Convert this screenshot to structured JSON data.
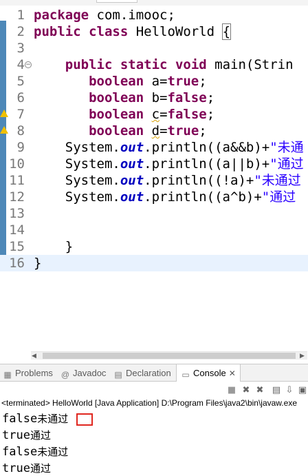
{
  "editor": {
    "lines": [
      {
        "num": "1",
        "tokens": [
          {
            "t": "package",
            "c": "kw"
          },
          {
            "t": " com.imooc;",
            "c": ""
          }
        ]
      },
      {
        "num": "2",
        "tokens": [
          {
            "t": "public",
            "c": "kw"
          },
          {
            "t": " ",
            "c": ""
          },
          {
            "t": "class",
            "c": "kw"
          },
          {
            "t": " HelloWorld ",
            "c": ""
          },
          {
            "t": "{",
            "c": "brace"
          }
        ]
      },
      {
        "num": "3",
        "tokens": []
      },
      {
        "num": "4",
        "tokens": [
          {
            "t": "    ",
            "c": ""
          },
          {
            "t": "public",
            "c": "kw"
          },
          {
            "t": " ",
            "c": ""
          },
          {
            "t": "static",
            "c": "kw"
          },
          {
            "t": " ",
            "c": ""
          },
          {
            "t": "void",
            "c": "kw"
          },
          {
            "t": " main(Strin",
            "c": ""
          }
        ]
      },
      {
        "num": "5",
        "tokens": [
          {
            "t": "       ",
            "c": ""
          },
          {
            "t": "boolean",
            "c": "kw"
          },
          {
            "t": " a=",
            "c": ""
          },
          {
            "t": "true",
            "c": "kw"
          },
          {
            "t": ";",
            "c": ""
          }
        ]
      },
      {
        "num": "6",
        "tokens": [
          {
            "t": "       ",
            "c": ""
          },
          {
            "t": "boolean",
            "c": "kw"
          },
          {
            "t": " b=",
            "c": ""
          },
          {
            "t": "false",
            "c": "kw"
          },
          {
            "t": ";",
            "c": ""
          }
        ]
      },
      {
        "num": "7",
        "tokens": [
          {
            "t": "       ",
            "c": ""
          },
          {
            "t": "boolean",
            "c": "kw"
          },
          {
            "t": " ",
            "c": ""
          },
          {
            "t": "c",
            "c": "squig"
          },
          {
            "t": "=",
            "c": ""
          },
          {
            "t": "false",
            "c": "kw"
          },
          {
            "t": ";",
            "c": ""
          }
        ]
      },
      {
        "num": "8",
        "tokens": [
          {
            "t": "       ",
            "c": ""
          },
          {
            "t": "boolean",
            "c": "kw"
          },
          {
            "t": " ",
            "c": ""
          },
          {
            "t": "d",
            "c": "squig"
          },
          {
            "t": "=",
            "c": ""
          },
          {
            "t": "true",
            "c": "kw"
          },
          {
            "t": ";",
            "c": ""
          }
        ]
      },
      {
        "num": "9",
        "tokens": [
          {
            "t": "    System.",
            "c": ""
          },
          {
            "t": "out",
            "c": "fld"
          },
          {
            "t": ".println((a&&b)+",
            "c": ""
          },
          {
            "t": "\"未通",
            "c": "str"
          }
        ]
      },
      {
        "num": "10",
        "tokens": [
          {
            "t": "    System.",
            "c": ""
          },
          {
            "t": "out",
            "c": "fld"
          },
          {
            "t": ".println((a||b)+",
            "c": ""
          },
          {
            "t": "\"通过",
            "c": "str"
          }
        ]
      },
      {
        "num": "11",
        "tokens": [
          {
            "t": "    System.",
            "c": ""
          },
          {
            "t": "out",
            "c": "fld"
          },
          {
            "t": ".println((!a)+",
            "c": ""
          },
          {
            "t": "\"未通过",
            "c": "str"
          }
        ]
      },
      {
        "num": "12",
        "tokens": [
          {
            "t": "    System.",
            "c": ""
          },
          {
            "t": "out",
            "c": "fld"
          },
          {
            "t": ".println((a^b)+",
            "c": ""
          },
          {
            "t": "\"通过",
            "c": "str"
          }
        ]
      },
      {
        "num": "13",
        "tokens": []
      },
      {
        "num": "14",
        "tokens": []
      },
      {
        "num": "15",
        "tokens": [
          {
            "t": "    }",
            "c": ""
          }
        ]
      },
      {
        "num": "16",
        "tokens": [
          {
            "t": "}",
            "c": ""
          }
        ]
      }
    ],
    "fold_marker": "−"
  },
  "views": {
    "tabs": [
      {
        "label": "Problems",
        "icon": "problems-icon",
        "glyph": "▦"
      },
      {
        "label": "Javadoc",
        "icon": "javadoc-icon",
        "glyph": "@"
      },
      {
        "label": "Declaration",
        "icon": "declaration-icon",
        "glyph": "▤"
      },
      {
        "label": "Console",
        "icon": "console-icon",
        "glyph": "▭",
        "close": "✕"
      }
    ]
  },
  "console": {
    "process": "<terminated> HelloWorld [Java Application] D:\\Program Files\\java2\\bin\\javaw.exe",
    "output": [
      {
        "value": "false",
        "text": "未通过"
      },
      {
        "value": "true",
        "text": "通过"
      },
      {
        "value": "false",
        "text": "未通过"
      },
      {
        "value": "true",
        "text": "通过"
      }
    ]
  },
  "colors": {
    "keyword": "#7f0055",
    "string": "#2a00ff",
    "field": "#0000c0",
    "annotation_box": "#e0271f"
  }
}
